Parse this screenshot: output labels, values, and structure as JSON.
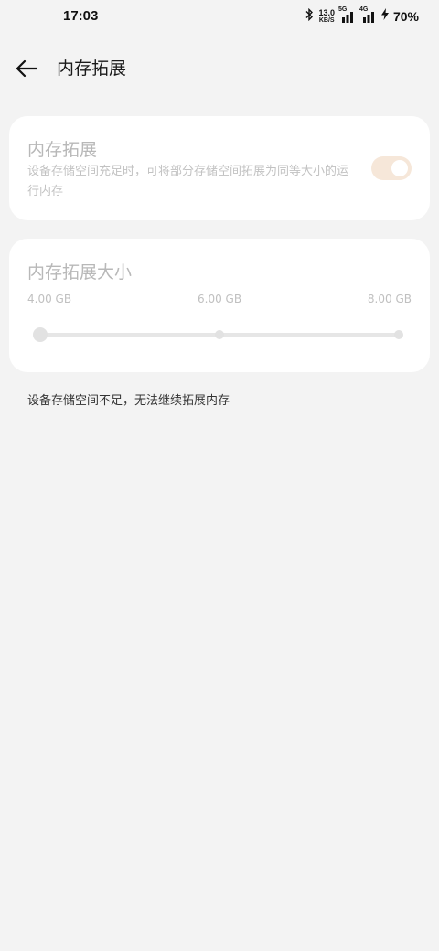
{
  "status_bar": {
    "time": "17:03",
    "net_speed_value": "13.0",
    "net_speed_unit": "KB/S",
    "signal1_tag": "5G",
    "signal2_tag": "4G",
    "battery": "70%"
  },
  "header": {
    "title": "内存拓展"
  },
  "memory_expansion": {
    "title": "内存拓展",
    "description": "设备存储空间充足时，可将部分存储空间拓展为同等大小的运行内存",
    "toggle_state": "on (disabled)"
  },
  "expansion_size": {
    "title": "内存拓展大小",
    "ticks": [
      "4.00 GB",
      "6.00 GB",
      "8.00 GB"
    ],
    "selected": "4.00 GB"
  },
  "footnote": "设备存储空间不足，无法继续拓展内存",
  "colors": {
    "background": "#f3f3f3",
    "card": "#ffffff",
    "toggle_track": "#f6e7d9",
    "disabled_text": "#b8b8b8"
  }
}
